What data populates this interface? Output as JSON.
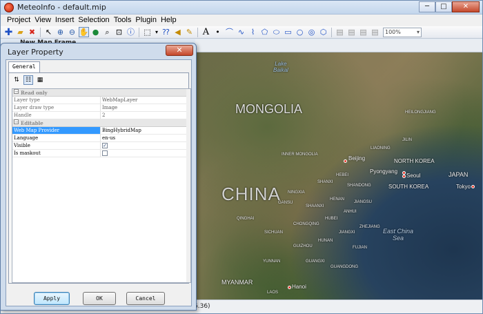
{
  "window": {
    "title": "MeteoInfo - default.mip",
    "minimize_label": "─",
    "maximize_label": "□",
    "close_label": "✕"
  },
  "menu": [
    "Project",
    "View",
    "Insert",
    "Selection",
    "Tools",
    "Plugin",
    "Help"
  ],
  "toolbar": {
    "icons": [
      "add-layer-icon",
      "open-folder-icon",
      "remove-layer-icon",
      "select-icon",
      "zoom-in-icon",
      "zoom-out-icon",
      "pan-icon",
      "full-extent-icon",
      "zoom-layer-icon",
      "zoom-undo-icon",
      "identify-icon",
      "select-rect-icon",
      "measure-icon",
      "label-icon",
      "edit-icon",
      "text-icon",
      "point-icon",
      "polyline-icon",
      "freehand-icon",
      "curve-icon",
      "polygon-icon",
      "curve-polygon-icon",
      "rectangle-icon",
      "circle-icon",
      "ellipse-icon",
      "freehand-polygon-icon"
    ],
    "zoom_value": "100%"
  },
  "map_frame": {
    "label": "New Map Frame"
  },
  "map": {
    "labels": {
      "mongolia": "MONGOLIA",
      "china": "CHINA",
      "myanmar": "MYANMAR",
      "japan": "JAPAN",
      "north_korea": "NORTH KOREA",
      "south_korea": "SOUTH KOREA",
      "beijing": "Beijing",
      "pyongyang": "Pyongyang",
      "seoul": "Seoul",
      "tokyo": "Tokyo",
      "hanoi": "Hanoi",
      "lake_baikal": "Lake\nBaikal",
      "east_china_sea": "East China\nSea",
      "liaoning": "LIAONING",
      "heilongjiang": "HEILONGJIANG",
      "jilin": "JILIN",
      "hebei": "HEBEI",
      "shandong": "SHANDONG",
      "henan": "HENAN",
      "jiangsu": "JIANGSU",
      "anhui": "ANHUI",
      "hubei": "HUBEI",
      "hunan": "HUNAN",
      "jiangxi": "JIANGXI",
      "fujian": "FUJIAN",
      "guangdong": "GUANGDONG",
      "guangxi": "GUANGXI",
      "guizhou": "GUIZHOU",
      "sichuan": "SICHUAN",
      "yunnan": "YUNNAN",
      "chongqing": "CHONGQING",
      "shaanxi": "SHAANXI",
      "shanxi": "SHANXI",
      "gansu": "GANSU",
      "qinghai": "QINGHAI",
      "ningxia": "NINGXIA",
      "inner_mongolia": "INNER MONGOLIA",
      "zhejiang": "ZHEJIANG",
      "laos": "LAOS"
    }
  },
  "status": {
    "coords": "6.36)"
  },
  "dialog": {
    "title": "Layer Property",
    "close_label": "✕",
    "tab": "General",
    "categories": {
      "read_only": "Read only",
      "editable": "Editable"
    },
    "read_only_rows": [
      {
        "name": "Layer type",
        "value": "WebMapLayer"
      },
      {
        "name": "Layer draw type",
        "value": "Image"
      },
      {
        "name": "Handle",
        "value": "2"
      }
    ],
    "editable_rows": [
      {
        "name": "Web Map Provider",
        "value": "BingHybridMap"
      },
      {
        "name": "Language",
        "value": "en-us"
      }
    ],
    "check_rows": [
      {
        "name": "Visible",
        "checked": true,
        "mark": "✓"
      },
      {
        "name": "Is maskout",
        "checked": false,
        "mark": ""
      }
    ],
    "buttons": {
      "apply": "Apply",
      "ok": "OK",
      "cancel": "Cancel"
    }
  }
}
